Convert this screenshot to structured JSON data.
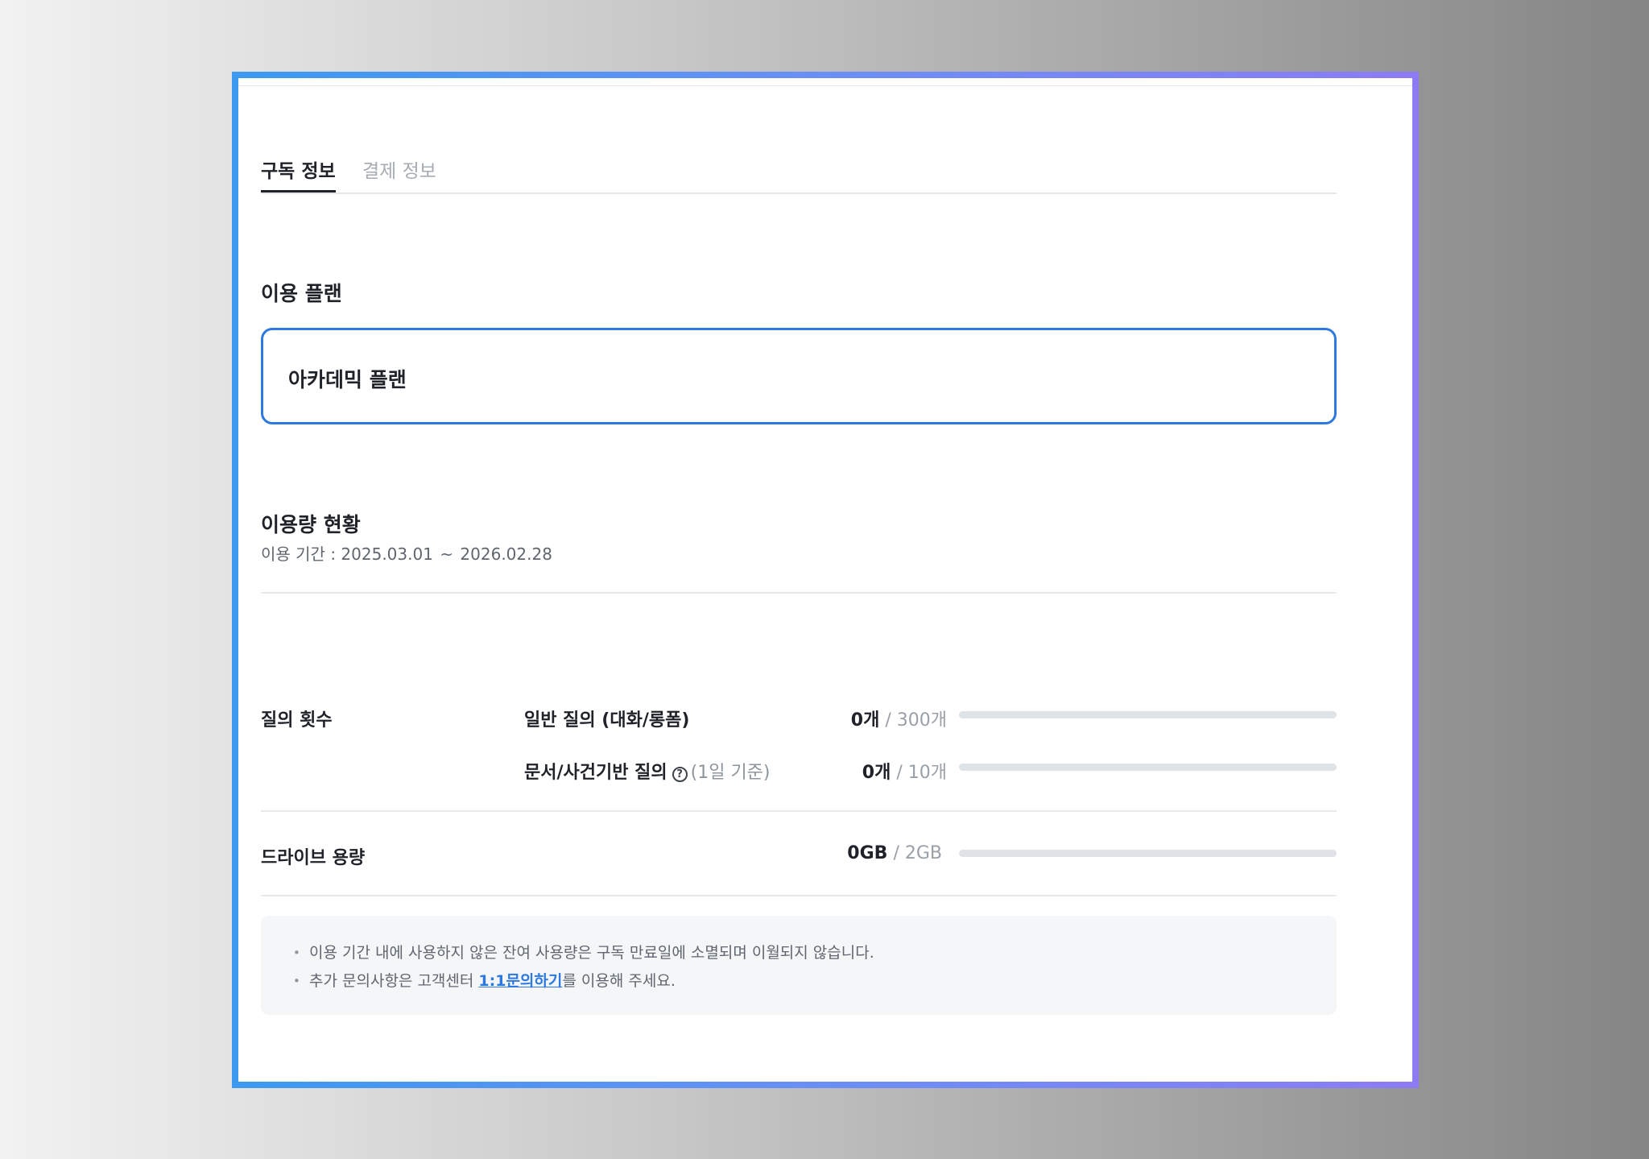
{
  "tabs": [
    {
      "label": "구독 정보",
      "active": true
    },
    {
      "label": "결제 정보",
      "active": false
    }
  ],
  "plan": {
    "section_title": "이용 플랜",
    "name": "아카데믹 플랜"
  },
  "usage": {
    "section_title": "이용량 현황",
    "period_label": "이용 기간 :",
    "period_start": "2025.03.01",
    "period_sep": "~",
    "period_end": "2026.02.28",
    "queries": {
      "label": "질의 횟수",
      "items": [
        {
          "label": "일반 질의 (대화/롱폼)",
          "used": "0개",
          "limit": "300개",
          "fraction": 0
        },
        {
          "label": "문서/사건기반 질의",
          "help_icon": "question-circle-icon",
          "basis": "(1일 기준)",
          "used": "0개",
          "limit": "10개",
          "fraction": 0
        }
      ]
    },
    "drive": {
      "label": "드라이브 용량",
      "used": "0GB",
      "limit": "2GB",
      "fraction": 0
    },
    "slash": "/"
  },
  "notice": {
    "line1": "이용 기간 내에 사용하지 않은 잔여 사용량은 구독 만료일에 소멸되며 이월되지 않습니다.",
    "line2_prefix": "추가 문의사항은 고객센터 ",
    "line2_link": "1:1문의하기",
    "line2_suffix": "를 이용해 주세요."
  },
  "colors": {
    "accent": "#2d79e0",
    "frame_start": "#3b9af0",
    "frame_end": "#8c7cf4"
  }
}
